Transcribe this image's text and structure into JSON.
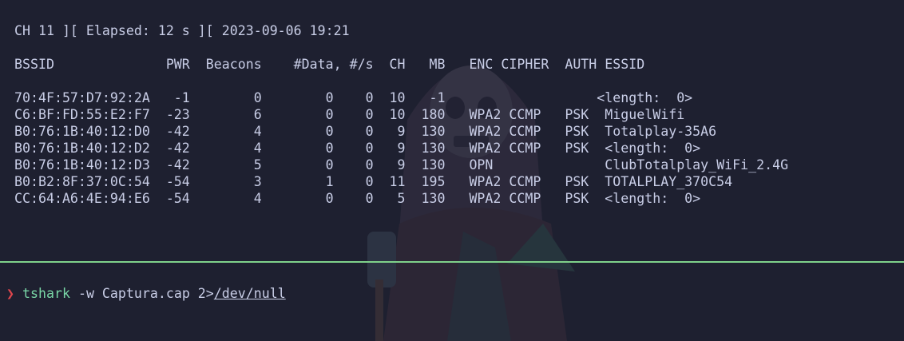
{
  "terminal": {
    "status_line": "CH 11 ][ Elapsed: 12 s ][ 2023-09-06 19:21",
    "table_header": "BSSID              PWR  Beacons    #Data, #/s  CH   MB   ENC CIPHER  AUTH ESSID",
    "rows": [
      "70:4F:57:D7:92:2A   -1        0        0    0  10   -1                   <length:  0>",
      "C6:BF:FD:55:E2:F7  -23        6        0    0  10  180   WPA2 CCMP   PSK  MiguelWifi",
      "B0:76:1B:40:12:D0  -42        4        0    0   9  130   WPA2 CCMP   PSK  Totalplay-35A6",
      "B0:76:1B:40:12:D2  -42        4        0    0   9  130   WPA2 CCMP   PSK  <length:  0>",
      "B0:76:1B:40:12:D3  -42        5        0    0   9  130   OPN              ClubTotalplay_WiFi_2.4G",
      "B0:B2:8F:37:0C:54  -54        3        1    0  11  195   WPA2 CCMP   PSK  TOTALPLAY_370C54",
      "CC:64:A6:4E:94:E6  -54        4        0    0   5  130   WPA2 CCMP   PSK  <length:  0>"
    ]
  },
  "prompt": {
    "symbol": "❯",
    "command": "tshark",
    "args": "-w Captura.cap 2>",
    "redirect_target": "/dev/null"
  },
  "colors": {
    "background": "#1e2030",
    "text": "#c8cde6",
    "divider": "#7fd18a",
    "prompt_symbol": "#e0464d",
    "command": "#79d6a6"
  },
  "icons": {
    "watermark": "skeleton-figure-wallpaper-icon"
  }
}
